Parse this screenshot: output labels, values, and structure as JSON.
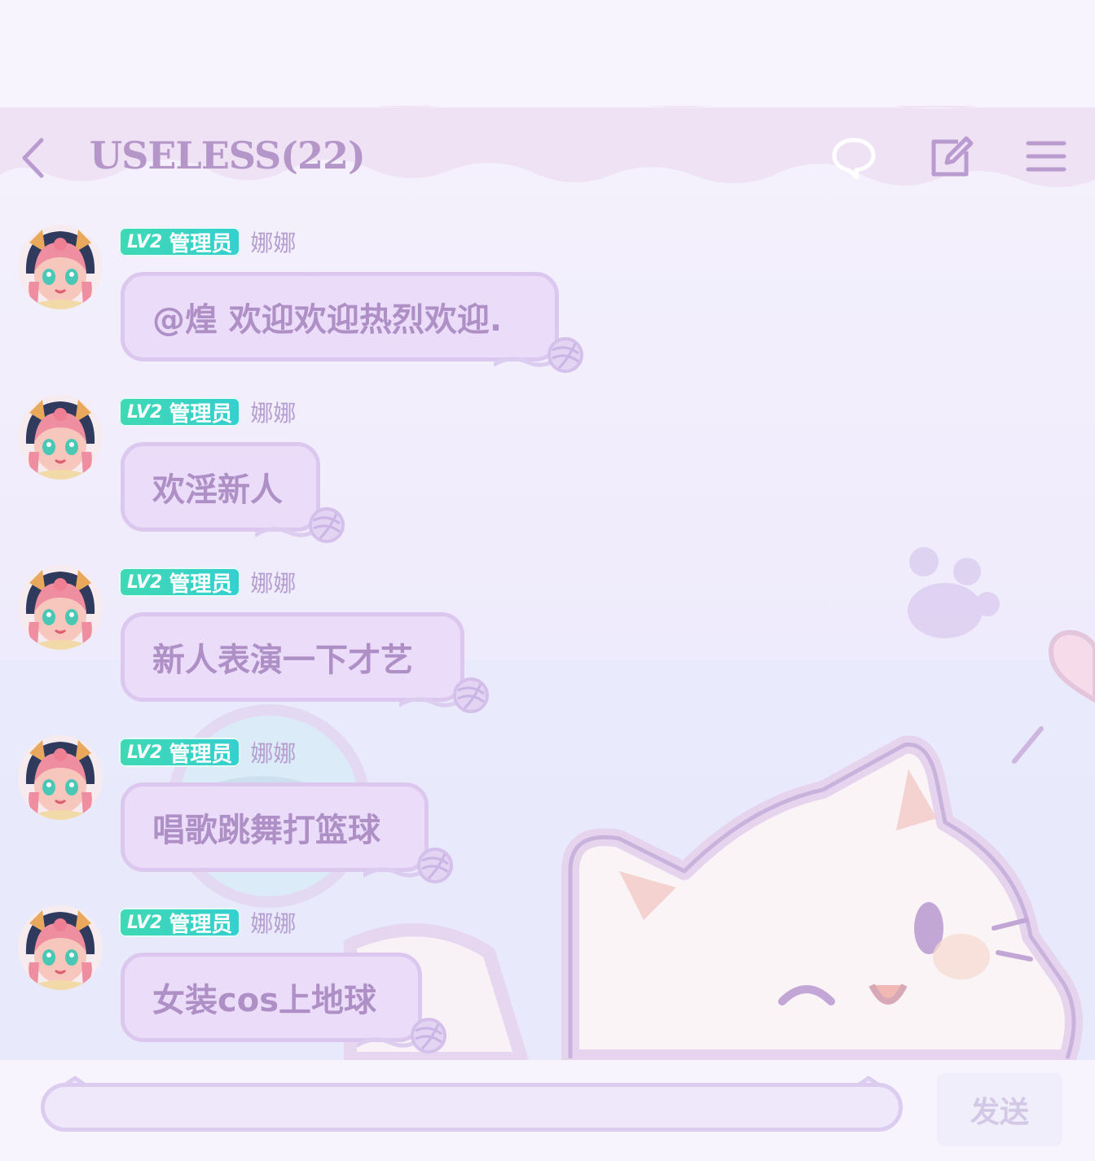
{
  "header": {
    "title": "USELESS(22)",
    "back_icon": "chevron-left-icon",
    "chat_icon": "speech-bubble-icon",
    "edit_icon": "edit-icon",
    "menu_icon": "menu-icon"
  },
  "messages": [
    {
      "level": "LV2",
      "role": "管理员",
      "nickname": "娜娜",
      "text": "@煌 欢迎欢迎热烈欢迎."
    },
    {
      "level": "LV2",
      "role": "管理员",
      "nickname": "娜娜",
      "text": "欢淫新人"
    },
    {
      "level": "LV2",
      "role": "管理员",
      "nickname": "娜娜",
      "text": "新人表演一下才艺"
    },
    {
      "level": "LV2",
      "role": "管理员",
      "nickname": "娜娜",
      "text": "唱歌跳舞打篮球"
    },
    {
      "level": "LV2",
      "role": "管理员",
      "nickname": "娜娜",
      "text": "女装cos上地球"
    }
  ],
  "composer": {
    "input_value": "",
    "send_label": "发送"
  },
  "colors": {
    "accent": "#b596c8",
    "badge": "#3fd9b4",
    "bubble_fill": "#ebdcf9",
    "bubble_border": "#dcc8ef",
    "bubble_text": "#ae8fc6"
  }
}
